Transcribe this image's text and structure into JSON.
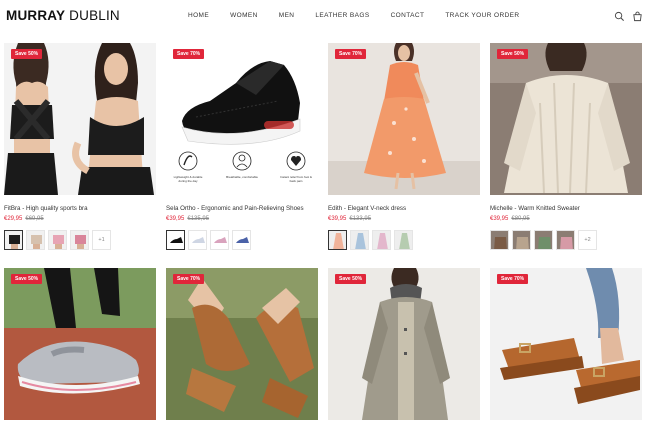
{
  "brand": {
    "bold": "MURRAY",
    "light": "DUBLIN"
  },
  "nav": [
    {
      "label": "HOME"
    },
    {
      "label": "WOMEN"
    },
    {
      "label": "MEN"
    },
    {
      "label": "LEATHER BAGS"
    },
    {
      "label": "CONTACT"
    },
    {
      "label": "TRACK YOUR ORDER"
    }
  ],
  "header_icons": [
    "search-icon",
    "cart-icon"
  ],
  "colors": {
    "accent": "#e0263a",
    "text": "#333333"
  },
  "products": [
    {
      "badge": "Save 50%",
      "title": "FitBra - High quality sports bra",
      "price": "€29,95",
      "old_price": "€69,95",
      "swatch_more": "+1",
      "feature_captions": []
    },
    {
      "badge": "Save 70%",
      "title": "Sela Ortho - Ergonomic and Pain-Relieving Shoes",
      "price": "€39,95",
      "old_price": "€135,95",
      "swatch_more": "",
      "feature_captions": [
        "Lightweight & durable during the day",
        "Breathable, comfortable",
        "Instant relief from foot & back pain"
      ]
    },
    {
      "badge": "Save 70%",
      "title": "Edith - Elegant V-neck dress",
      "price": "€39,95",
      "old_price": "€133,95",
      "swatch_more": "",
      "feature_captions": []
    },
    {
      "badge": "Save 50%",
      "title": "Michelle - Warm Knitted Sweater",
      "price": "€39,95",
      "old_price": "€80,95",
      "swatch_more": "+2",
      "feature_captions": []
    },
    {
      "badge": "Save 50%",
      "title": "",
      "price": "",
      "old_price": "",
      "swatch_more": "",
      "feature_captions": []
    },
    {
      "badge": "Save 70%",
      "title": "",
      "price": "",
      "old_price": "",
      "swatch_more": "",
      "feature_captions": []
    },
    {
      "badge": "Save 50%",
      "title": "",
      "price": "",
      "old_price": "",
      "swatch_more": "",
      "feature_captions": []
    },
    {
      "badge": "Save 70%",
      "title": "",
      "price": "",
      "old_price": "",
      "swatch_more": "",
      "feature_captions": []
    }
  ]
}
